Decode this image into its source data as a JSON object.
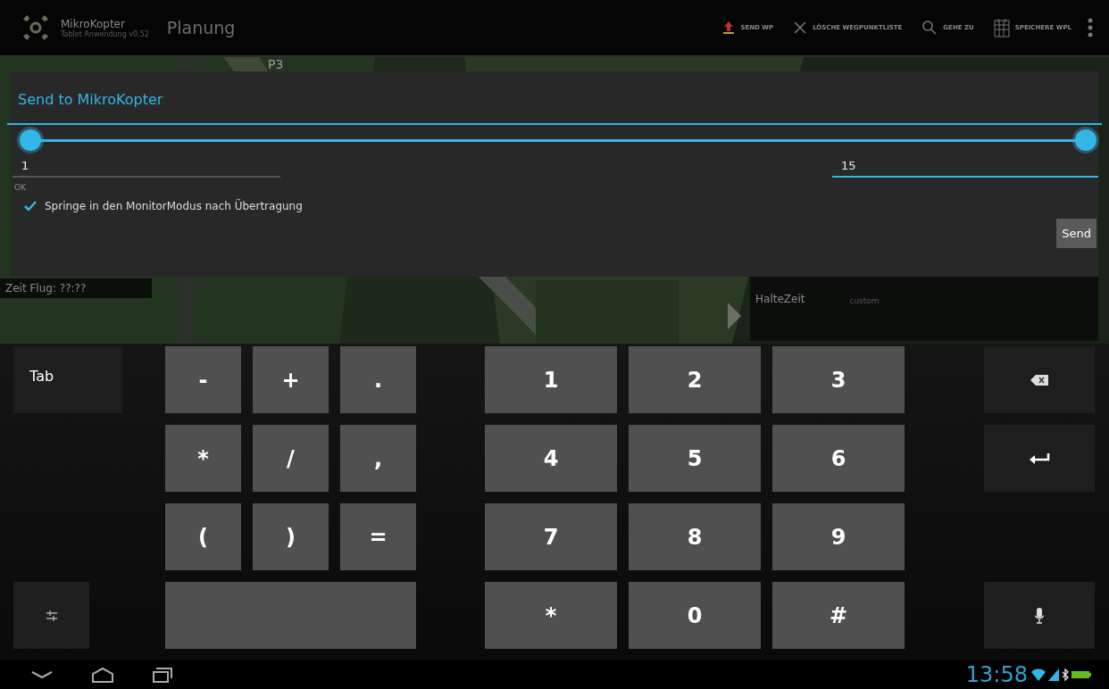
{
  "action_bar": {
    "app_name": "MikroKopter",
    "app_subtitle": "Tablet Anwendung v0.52",
    "title": "Planung",
    "actions": [
      {
        "label": "SEND WP",
        "kind": "upload"
      },
      {
        "label": "LÖSCHE WEGPUNKTLISTE",
        "kind": "delete"
      },
      {
        "label": "GEHE ZU",
        "kind": "search"
      },
      {
        "label": "SPEICHERE WPL",
        "kind": "save"
      }
    ]
  },
  "map": {
    "marker_label": "P3",
    "flight_time": "Zeit Flug: ??:??",
    "hold_time_label": "HalteZeit",
    "hold_time_value": "custom"
  },
  "dialog": {
    "title": "Send to MikroKopter",
    "thumbs": [
      {
        "level": 0
      },
      {
        "level": 1
      }
    ],
    "fields": [
      {
        "value": "1",
        "focused": false
      },
      {
        "value": "15",
        "focused": true
      }
    ],
    "status": "OK",
    "checkbox": {
      "label": "Springe in den MonitorModus nach Übertragung",
      "checked": true
    },
    "send_button": "Send"
  },
  "keyboard": {
    "rows": [
      {
        "left": {
          "kind": "text",
          "label": "Tab"
        },
        "symbols": [
          {
            "kind": "text",
            "label": "-"
          },
          {
            "kind": "text",
            "label": "+"
          },
          {
            "kind": "text",
            "label": "."
          }
        ],
        "digits": [
          {
            "kind": "text",
            "label": "1"
          },
          {
            "kind": "text",
            "label": "2"
          },
          {
            "kind": "text",
            "label": "3"
          }
        ],
        "right": {
          "kind": "backspace"
        }
      },
      {
        "symbols": [
          {
            "kind": "text",
            "label": "*"
          },
          {
            "kind": "text",
            "label": "/"
          },
          {
            "kind": "text",
            "label": ","
          }
        ],
        "digits": [
          {
            "kind": "text",
            "label": "4"
          },
          {
            "kind": "text",
            "label": "5"
          },
          {
            "kind": "text",
            "label": "6"
          }
        ],
        "right": {
          "kind": "enter"
        }
      },
      {
        "symbols": [
          {
            "kind": "text",
            "label": "("
          },
          {
            "kind": "text",
            "label": ")"
          },
          {
            "kind": "text",
            "label": "="
          }
        ],
        "digits": [
          {
            "kind": "text",
            "label": "7"
          },
          {
            "kind": "text",
            "label": "8"
          },
          {
            "kind": "text",
            "label": "9"
          }
        ]
      },
      {
        "left": {
          "kind": "settings"
        },
        "symbols": [
          {
            "kind": "space"
          }
        ],
        "digits": [
          {
            "kind": "text",
            "label": "*"
          },
          {
            "kind": "text",
            "label": "0"
          },
          {
            "kind": "text",
            "label": "#"
          }
        ],
        "right": {
          "kind": "mic"
        }
      }
    ]
  },
  "status_bar": {
    "time": "13:58"
  }
}
